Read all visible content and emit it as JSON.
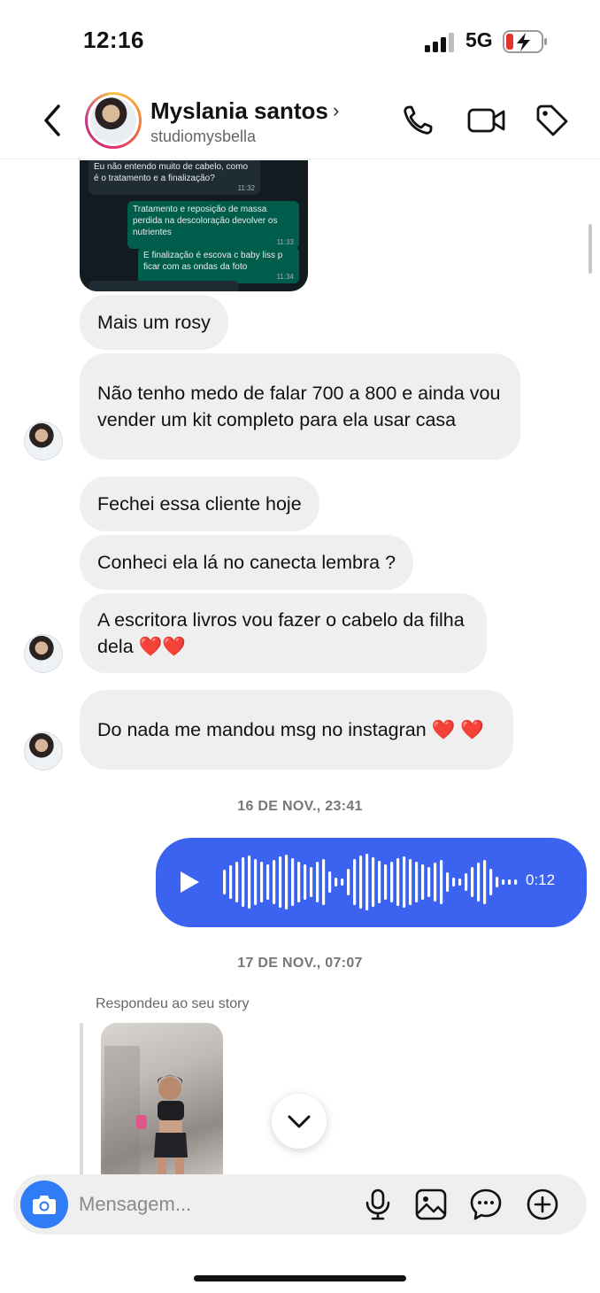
{
  "status_bar": {
    "time": "12:16",
    "network": "5G"
  },
  "header": {
    "contact_name": "Myslania santos",
    "username": "studiomysbella",
    "chevron": "›"
  },
  "forwarded_screenshot": {
    "messages": [
      {
        "text": "Eu não entendo muito de cabelo, como é o tratamento e a finalização?",
        "time": "11:32"
      },
      {
        "text": "Tratamento e reposição de massa perdida na descoloração devolver os nutrientes",
        "time": "11:33"
      },
      {
        "text": "E finalização é escova c baby liss p ficar com as ondas da foto",
        "time": "11:34"
      }
    ]
  },
  "messages": [
    {
      "text": "Mais um rosy"
    },
    {
      "text": "Não tenho medo de falar 700 a 800 e ainda vou vender um kit completo para ela usar casa"
    },
    {
      "text": "Fechei essa cliente hoje"
    },
    {
      "text": "Conheci ela lá no canecta lembra ?"
    },
    {
      "text": "A escritora livros vou fazer o cabelo da filha dela ❤️❤️"
    },
    {
      "text": "Do nada me mandou msg no instagran ❤️ ❤️"
    }
  ],
  "dates": {
    "first": "16 DE NOV., 23:41",
    "second": "17 DE NOV., 07:07"
  },
  "voice_message": {
    "duration": "0:12"
  },
  "story_reply": {
    "label": "Respondeu ao seu story"
  },
  "composer": {
    "placeholder": "Mensagem..."
  },
  "icons": {
    "back": "chevron-left-icon",
    "call": "phone-icon",
    "video": "video-camera-icon",
    "tag": "tag-icon",
    "camera": "camera-icon",
    "mic": "microphone-icon",
    "gallery": "image-icon",
    "sticker": "chat-bubble-icon",
    "add": "plus-circle-icon",
    "play": "play-icon",
    "scroll": "chevron-down-icon"
  },
  "colors": {
    "voice_bubble": "#3b63f0",
    "camera_button": "#2f7cf6",
    "incoming_bubble": "#efefef"
  }
}
